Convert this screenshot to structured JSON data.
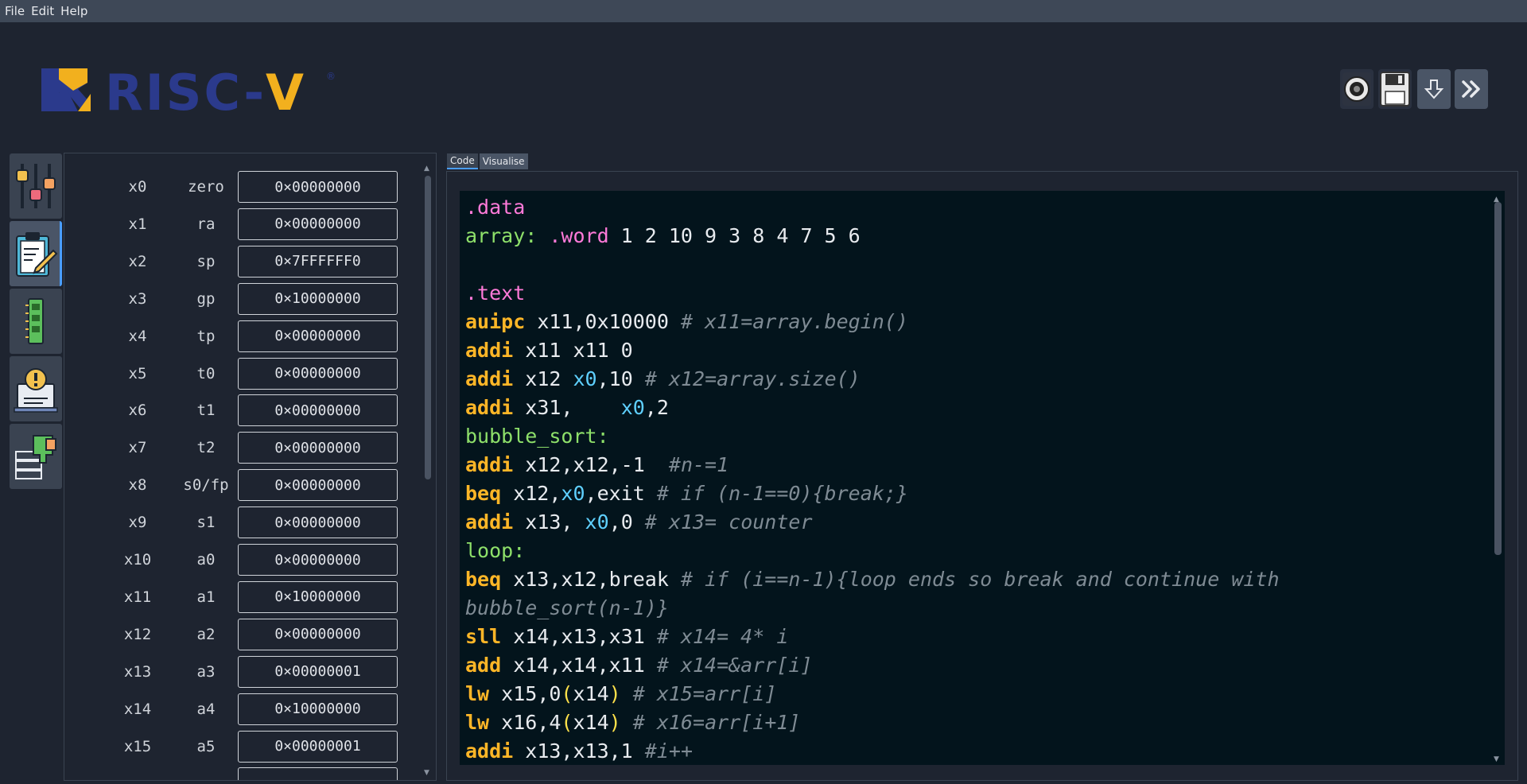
{
  "menu": {
    "file": "File",
    "edit": "Edit",
    "help": "Help"
  },
  "logo": {
    "text": "RISC-V",
    "registered": "®"
  },
  "colors": {
    "background": "#1e2430",
    "menubar": "#3e4857",
    "accent_blue": "#2b3a8c",
    "accent_gold": "#f2b01e",
    "editor_bg": "#03141c"
  },
  "toolbar": [
    {
      "icon": "gear-icon",
      "label": "settings"
    },
    {
      "icon": "floppy-disk-icon",
      "label": "save"
    },
    {
      "icon": "arrow-down-icon",
      "label": "step"
    },
    {
      "icon": "double-chevron-right-icon",
      "label": "run"
    }
  ],
  "sidenav": [
    {
      "icon": "sliders-icon"
    },
    {
      "icon": "clipboard-edit-icon",
      "active": true
    },
    {
      "icon": "memory-chip-icon"
    },
    {
      "icon": "info-laptop-icon"
    },
    {
      "icon": "server-paint-icon"
    }
  ],
  "registers": [
    {
      "num": "x0",
      "name": "zero",
      "value": "0×00000000"
    },
    {
      "num": "x1",
      "name": "ra",
      "value": "0×00000000"
    },
    {
      "num": "x2",
      "name": "sp",
      "value": "0×7FFFFFF0"
    },
    {
      "num": "x3",
      "name": "gp",
      "value": "0×10000000"
    },
    {
      "num": "x4",
      "name": "tp",
      "value": "0×00000000"
    },
    {
      "num": "x5",
      "name": "t0",
      "value": "0×00000000"
    },
    {
      "num": "x6",
      "name": "t1",
      "value": "0×00000000"
    },
    {
      "num": "x7",
      "name": "t2",
      "value": "0×00000000"
    },
    {
      "num": "x8",
      "name": "s0/fp",
      "value": "0×00000000"
    },
    {
      "num": "x9",
      "name": "s1",
      "value": "0×00000000"
    },
    {
      "num": "x10",
      "name": "a0",
      "value": "0×00000000"
    },
    {
      "num": "x11",
      "name": "a1",
      "value": "0×10000000"
    },
    {
      "num": "x12",
      "name": "a2",
      "value": "0×00000000"
    },
    {
      "num": "x13",
      "name": "a3",
      "value": "0×00000001"
    },
    {
      "num": "x14",
      "name": "a4",
      "value": "0×10000000"
    },
    {
      "num": "x15",
      "name": "a5",
      "value": "0×00000001"
    }
  ],
  "tabs": {
    "code": "Code",
    "visualise": "Visualise"
  },
  "code_lines": [
    [
      [
        "dir",
        ".data"
      ]
    ],
    [
      [
        "lbl",
        "array: "
      ],
      [
        "dir",
        ".word"
      ],
      [
        "num",
        " 1 2 10 9 3 8 4 7 5 6"
      ]
    ],
    [],
    [
      [
        "dir",
        ".text"
      ]
    ],
    [
      [
        "ins",
        "auipc"
      ],
      [
        "reg",
        " x11,0x10000 "
      ],
      [
        "cmt",
        "# x11=array.begin()"
      ]
    ],
    [
      [
        "ins",
        "addi"
      ],
      [
        "reg",
        " x11 x11 0"
      ]
    ],
    [
      [
        "ins",
        "addi"
      ],
      [
        "reg",
        " x12 "
      ],
      [
        "x0",
        "x0"
      ],
      [
        "reg",
        ",10 "
      ],
      [
        "cmt",
        "# x12=array.size()"
      ]
    ],
    [
      [
        "ins",
        "addi"
      ],
      [
        "reg",
        " x31,    "
      ],
      [
        "x0",
        "x0"
      ],
      [
        "reg",
        ",2"
      ]
    ],
    [
      [
        "lbl",
        "bubble_sort:"
      ]
    ],
    [
      [
        "ins",
        "addi"
      ],
      [
        "reg",
        " x12,x12,-1  "
      ],
      [
        "cmt",
        "#n-=1"
      ]
    ],
    [
      [
        "ins",
        "beq"
      ],
      [
        "reg",
        " x12,"
      ],
      [
        "x0",
        "x0"
      ],
      [
        "reg",
        ",exit "
      ],
      [
        "cmt",
        "# if (n-1==0){break;}"
      ]
    ],
    [
      [
        "ins",
        "addi"
      ],
      [
        "reg",
        " x13, "
      ],
      [
        "x0",
        "x0"
      ],
      [
        "reg",
        ",0 "
      ],
      [
        "cmt",
        "# x13= counter"
      ]
    ],
    [
      [
        "lbl",
        "loop:"
      ]
    ],
    [
      [
        "ins",
        "beq"
      ],
      [
        "reg",
        " x13,x12,break "
      ],
      [
        "cmt",
        "# if (i==n-1){loop ends so break and continue with"
      ]
    ],
    [
      [
        "cmt",
        "bubble_sort(n-1)}"
      ]
    ],
    [
      [
        "ins",
        "sll"
      ],
      [
        "reg",
        " x14,x13,x31 "
      ],
      [
        "cmt",
        "# x14= 4* i"
      ]
    ],
    [
      [
        "ins",
        "add"
      ],
      [
        "reg",
        " x14,x14,x11 "
      ],
      [
        "cmt",
        "# x14=&arr[i]"
      ]
    ],
    [
      [
        "ins",
        "lw"
      ],
      [
        "reg",
        " x15,0"
      ],
      [
        "par",
        "("
      ],
      [
        "reg",
        "x14"
      ],
      [
        "par",
        ")"
      ],
      [
        "reg",
        " "
      ],
      [
        "cmt",
        "# x15=arr[i]"
      ]
    ],
    [
      [
        "ins",
        "lw"
      ],
      [
        "reg",
        " x16,4"
      ],
      [
        "par",
        "("
      ],
      [
        "reg",
        "x14"
      ],
      [
        "par",
        ")"
      ],
      [
        "reg",
        " "
      ],
      [
        "cmt",
        "# x16=arr[i+1]"
      ]
    ],
    [
      [
        "ins",
        "addi"
      ],
      [
        "reg",
        " x13,x13,1 "
      ],
      [
        "cmt",
        "#i++"
      ]
    ]
  ]
}
